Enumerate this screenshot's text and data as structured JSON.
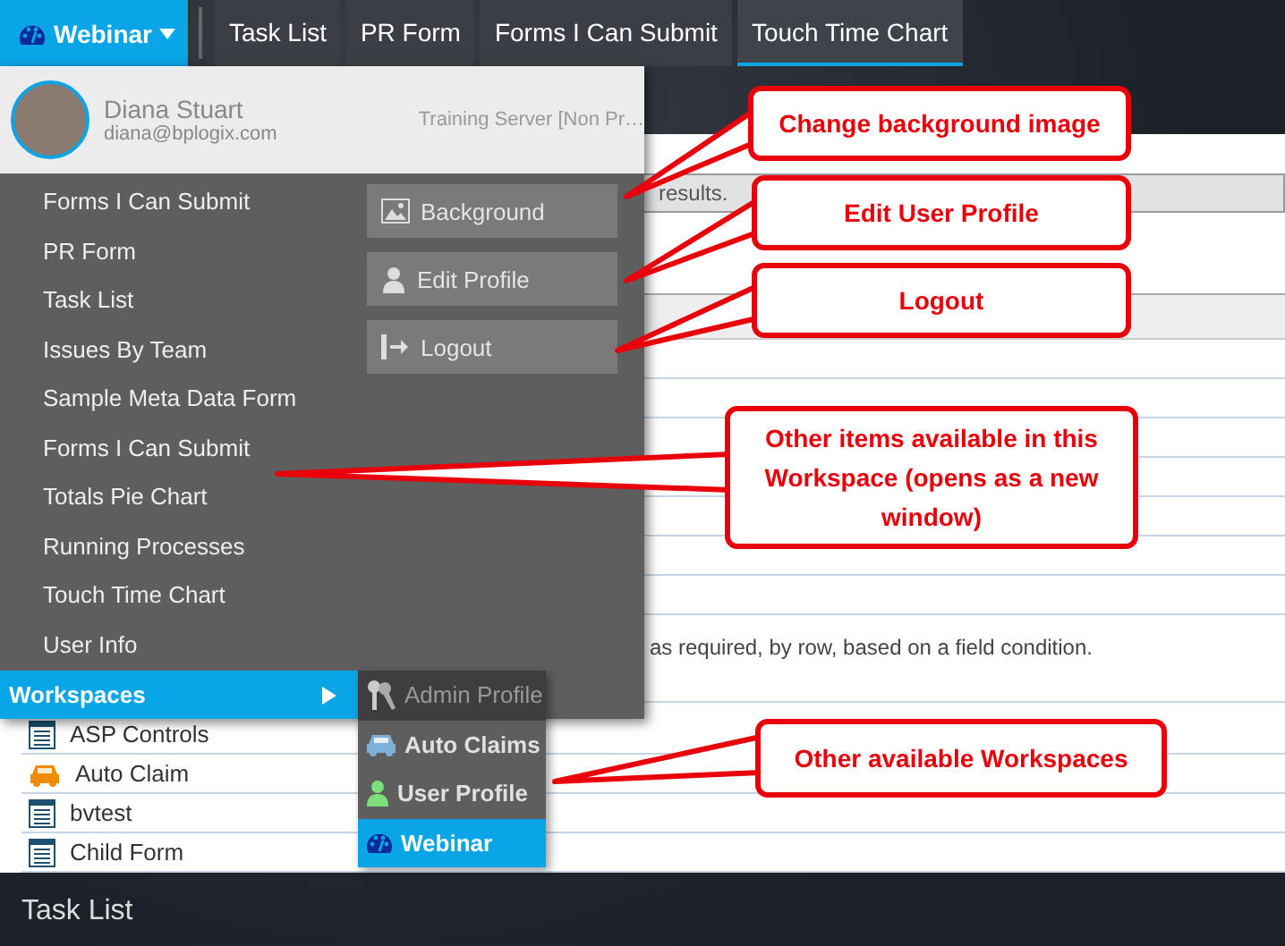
{
  "nav": {
    "workspace": "Webinar",
    "tabs": [
      {
        "label": "Task List",
        "selected": false
      },
      {
        "label": "PR Form",
        "selected": false
      },
      {
        "label": "Forms I Can Submit",
        "selected": false
      },
      {
        "label": "Touch Time Chart",
        "selected": true
      }
    ]
  },
  "page": {
    "notice": "results.",
    "description": "as required, by row, based on a field condition.",
    "rows": [
      {
        "name": "ASP Controls",
        "kind": "form"
      },
      {
        "name": "Auto Claim",
        "kind": "car"
      },
      {
        "name": "bvtest",
        "kind": "form"
      },
      {
        "name": "Child Form",
        "kind": "form"
      }
    ]
  },
  "user_menu": {
    "name": "Diana Stuart",
    "email": "diana@bplogix.com",
    "server": "Training Server [Non Pr…",
    "items": [
      "Forms I Can Submit",
      "PR Form",
      "Task List",
      "Issues By Team",
      "Sample Meta Data Form",
      "Forms I Can Submit",
      "Totals Pie Chart",
      "Running Processes",
      "Touch Time Chart",
      "User Info"
    ],
    "actions": [
      {
        "label": "Background",
        "kind": "image"
      },
      {
        "label": "Edit Profile",
        "kind": "person"
      },
      {
        "label": "Logout",
        "kind": "logout"
      }
    ],
    "workspaces_label": "Workspaces",
    "workspaces": [
      {
        "label": "Admin Profile",
        "kind": "keys",
        "selected": false,
        "disabled": true
      },
      {
        "label": "Auto Claims",
        "kind": "car",
        "selected": false,
        "disabled": false
      },
      {
        "label": "User Profile",
        "kind": "user",
        "selected": false,
        "disabled": false
      },
      {
        "label": "Webinar",
        "kind": "gauge",
        "selected": true,
        "disabled": false
      }
    ]
  },
  "footer": {
    "title": "Task List"
  },
  "callouts": [
    {
      "text": "Change background image"
    },
    {
      "text": "Edit User Profile"
    },
    {
      "text": "Logout"
    },
    {
      "text": "Other items available in this Workspace (opens as a new window)"
    },
    {
      "text": "Other available Workspaces"
    }
  ]
}
